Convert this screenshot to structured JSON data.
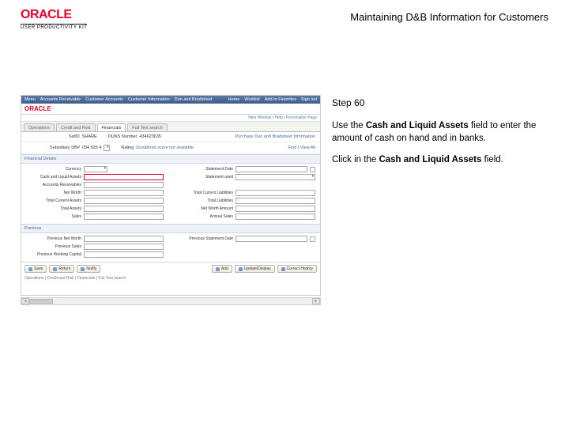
{
  "header": {
    "oracle": "ORACLE",
    "subtitle": "USER PRODUCTIVITY KIT",
    "page_title": "Maintaining D&B Information for Customers"
  },
  "instructions": {
    "step": "Step 60",
    "p1_a": "Use the ",
    "p1_b": "Cash and Liquid Assets",
    "p1_c": " field to enter the amount of cash on hand and in banks.",
    "p2_a": "Click in the ",
    "p2_b": "Cash and Liquid Assets",
    "p2_c": " field."
  },
  "app": {
    "top_left": [
      "Menu",
      "Accounts Receivable",
      "Customer Accounts",
      "Customer Information",
      "Dun and Bradstreet"
    ],
    "top_right": [
      "Home",
      "Worklist",
      "Add to Favorites",
      "Sign out"
    ],
    "right_links": "New Window | Help | Personalize Page",
    "tabs": [
      "Operations",
      "Credit and Risk",
      "Financials",
      "Full Text search"
    ],
    "info": {
      "setid_label": "SetID",
      "setid_value": "SHARE",
      "duns_label": "DUNS Number",
      "duns_value": "434623635",
      "section_link": "Purchase Dun and Bradstreet Information",
      "subsidiary_label": "Subsidiary DB#",
      "subsidiary_value": "034 525 4",
      "rating_label": "Rating",
      "rating_value": "Dun&Brad score not available",
      "lookup": "Find | View All"
    },
    "section1": "Financial Details",
    "form1": {
      "r1l": "Currency",
      "r1r_label": "Statement Date",
      "r2l": "Cash and Liquid Assets",
      "r2r_label": "Statement used",
      "r3l": "Accounts Receivables",
      "r4l": "Net Worth",
      "r4r1": "Total Current Liabilities",
      "r5l": "Total Current Assets",
      "r5r1": "Total Liabilities",
      "r6l": "Total Assets",
      "r6r1": "Net Worth Amount",
      "r7l": "Sales",
      "r7r1": "Annual Sales"
    },
    "section2": "Previous",
    "form2": {
      "r1l": "Previous Net Worth",
      "r1r": "Previous Statement Date",
      "r2l": "Previous Sales",
      "r3l": "Previous Working Capital"
    },
    "buttons": {
      "left": [
        "Save",
        "Return",
        "Notify"
      ],
      "right": [
        "Add",
        "Update/Display",
        "Correct History"
      ]
    },
    "footer": "Operations | Credit and Risk | Financials | Full Text search"
  }
}
